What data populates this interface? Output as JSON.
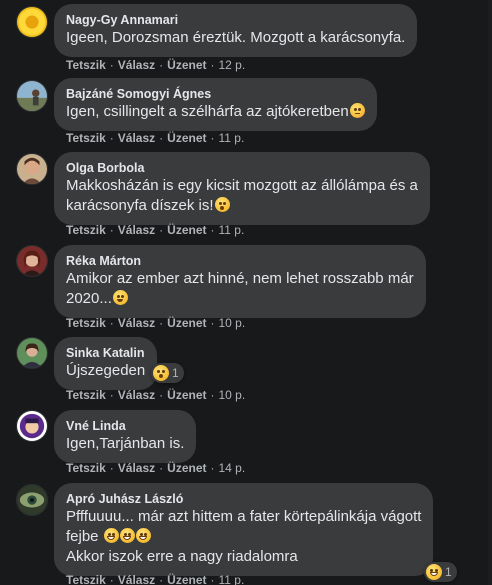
{
  "actions": {
    "like": "Tetszik",
    "reply": "Válasz",
    "message": "Üzenet",
    "separator": "·"
  },
  "comments": [
    {
      "author": "Nagy-Gy Annamari",
      "lines": [
        "Igeen, Dorozsman éreztük. Mozgott a karácsonyfa."
      ],
      "time": "12 p.",
      "avatar": "sunflower-avatar"
    },
    {
      "author": "Bajzáné Somogyi Ágnes",
      "lines": [
        "Igen, csillingelt a szélhárfa az ajtókeretben"
      ],
      "time": "11 p.",
      "avatar": "landscape-avatar",
      "emoji": "flushed-face-icon"
    },
    {
      "author": "Olga Borbola",
      "lines": [
        "Makkosházán is egy kicsit mozgott az állólámpa és a",
        "karácsonyfa díszek is!"
      ],
      "time": "11 p.",
      "avatar": "woman-avatar",
      "emoji": "astonished-face-icon"
    },
    {
      "author": "Réka Márton",
      "lines": [
        "Amikor az ember azt hinné, nem lehet rosszabb már",
        "2020..."
      ],
      "time": "10 p.",
      "avatar": "woman-red-avatar",
      "emoji": "sweat-smile-icon"
    },
    {
      "author": "Sinka Katalin",
      "lines": [
        "Újszegeden"
      ],
      "time": "10 p.",
      "avatar": "woman-outdoor-avatar",
      "reaction": {
        "emoji": "wow-reaction-icon",
        "count": "1"
      }
    },
    {
      "author": "Vné Linda",
      "lines": [
        "Igen,Tarjánban is."
      ],
      "time": "14 p.",
      "avatar": "cartoon-avatar"
    },
    {
      "author": "Apró Juhász László",
      "lines": [
        "Pfffuuuu... már azt hittem a fater körtepálinkája vágott",
        "fejbe",
        "Akkor iszok erre a nagy riadalomra"
      ],
      "time": "11 p.",
      "avatar": "eye-avatar",
      "emoji": "tears-of-joy-icon",
      "reaction": {
        "emoji": "haha-reaction-icon",
        "count": "1"
      }
    }
  ]
}
